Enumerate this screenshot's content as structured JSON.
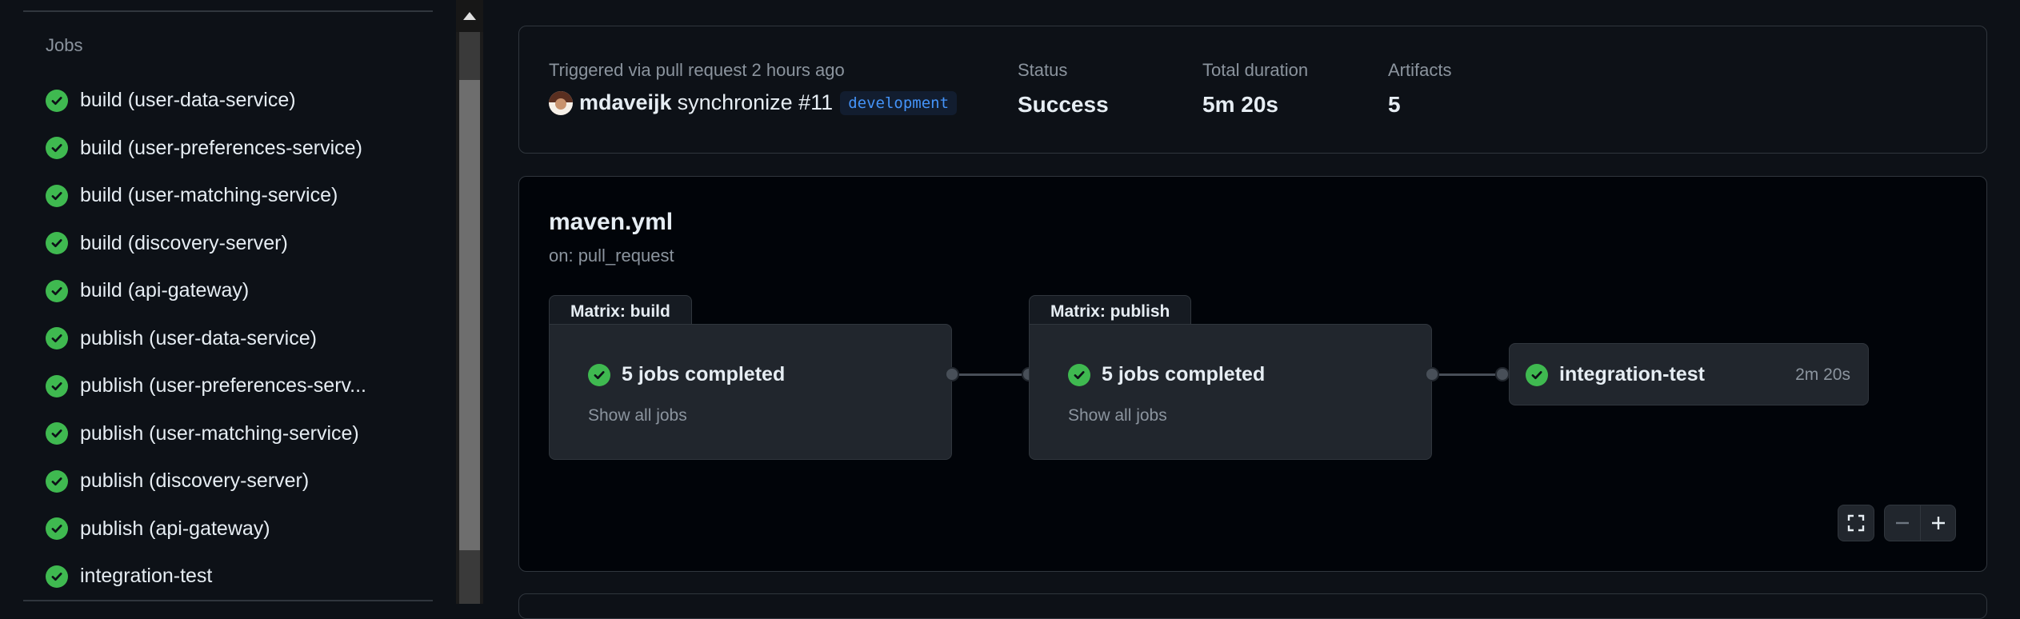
{
  "sidebar": {
    "heading": "Jobs",
    "jobs": [
      {
        "label": "build (user-data-service)"
      },
      {
        "label": "build (user-preferences-service)"
      },
      {
        "label": "build (user-matching-service)"
      },
      {
        "label": "build (discovery-server)"
      },
      {
        "label": "build (api-gateway)"
      },
      {
        "label": "publish (user-data-service)"
      },
      {
        "label": "publish (user-preferences-serv..."
      },
      {
        "label": "publish (user-matching-service)"
      },
      {
        "label": "publish (discovery-server)"
      },
      {
        "label": "publish (api-gateway)"
      },
      {
        "label": "integration-test"
      }
    ]
  },
  "summary": {
    "trigger_label": "Triggered via pull request 2 hours ago",
    "actor": "mdaveijk",
    "event": "synchronize #11",
    "branch": "development",
    "status_label": "Status",
    "status_value": "Success",
    "duration_label": "Total duration",
    "duration_value": "5m 20s",
    "artifacts_label": "Artifacts",
    "artifacts_value": "5"
  },
  "workflow": {
    "file": "maven.yml",
    "trigger": "on: pull_request",
    "matrix_build": {
      "tab": "Matrix: build",
      "title": "5 jobs completed",
      "link": "Show all jobs"
    },
    "matrix_publish": {
      "tab": "Matrix: publish",
      "title": "5 jobs completed",
      "link": "Show all jobs"
    },
    "integration": {
      "title": "integration-test",
      "duration": "2m 20s"
    }
  },
  "colors": {
    "success": "#3fb950",
    "background": "#0d1117",
    "graph_background": "#010409",
    "branch_text": "#4493f8"
  }
}
